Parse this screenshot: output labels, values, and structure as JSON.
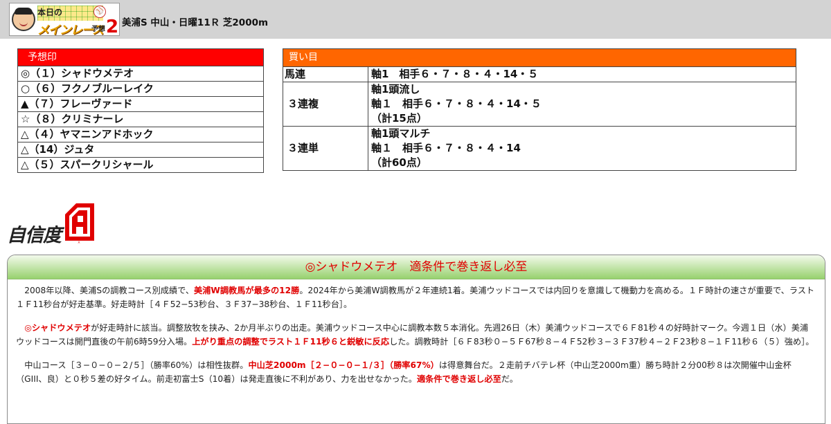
{
  "header": {
    "logo": {
      "line1": "本日の",
      "line2": "メインレース",
      "line3": "予想",
      "num": "2"
    },
    "race_title": "美浦S 中山・日曜11Ｒ 芝2000m"
  },
  "predictions": {
    "title": "予想印",
    "items": [
      "◎（１）シャドウメテオ",
      "○（６）フクノブルーレイク",
      "▲（７）フレーヴァード",
      "☆（８）クリミナーレ",
      "△（４）ヤマニンアドホック",
      "△（14）ジュタ",
      "△（５）スパークリシャール"
    ]
  },
  "bets": {
    "title": "買い目",
    "rows": [
      {
        "type": "馬連",
        "lines": [
          "軸1　相手６・７・８・４・14・５"
        ]
      },
      {
        "type": "３連複",
        "lines": [
          "軸1頭流し",
          "軸１　相手６・７・８・４・14・５",
          "（計15点）"
        ]
      },
      {
        "type": "３連単",
        "lines": [
          "軸1頭マルチ",
          "軸１　相手６・７・８・４・14",
          "（計60点）"
        ]
      }
    ]
  },
  "confidence": {
    "label": "自信度",
    "grade": "A"
  },
  "analysis": {
    "title": "◎シャドウメテオ　適条件で巻き返し必至",
    "p1": {
      "a": "2008年以降、美浦Sの調教コース別成績で、",
      "b": "美浦W調教馬が最多の12勝",
      "c": "。2024年から美浦W調教馬が２年連続1着。美浦ウッドコースでは内回りを意識して機動力を高める。１Ｆ時計の速さが重要で、ラスト１Ｆ11秒台が好走基準。好走時計［４Ｆ52−53秒台、３Ｆ37−38秒台、１Ｆ11秒台］。"
    },
    "p2": {
      "a": "◎シャドウメテオ",
      "b": "が好走時計に該当。調整放牧を挟み、2か月半ぶりの出走。美浦ウッドコース中心に調教本数５本消化。先週26日（木）美浦ウッドコースで６Ｆ81秒４の好時計マーク。今週１日（水）美浦ウッドコースは開門直後の午前6時59分入場。",
      "c": "上がり重点の調整でラスト１Ｆ11秒６と鋭敏に反応",
      "d": "した。調教時計［６Ｆ83秒０−５Ｆ67秒８−４Ｆ52秒３−３Ｆ37秒４−２Ｆ23秒８−１Ｆ11秒６（５）強め］。"
    },
    "p3": {
      "a": "中山コース［３−０−０−２/５］（勝率60%）は相性抜群。",
      "b": "中山芝2000m［２−０−０−１/３］（勝率67%）",
      "c": "は得意舞台だ。２走前チバテレ杯（中山芝2000m重）勝ち時計２分00秒８は次開催中山金杯（GIII、良）と０秒５差の好タイム。前走初富士S（10着）は発走直後に不利があり、力を出せなかった。",
      "d": "適条件で巻き返し必至",
      "e": "だ。"
    }
  }
}
